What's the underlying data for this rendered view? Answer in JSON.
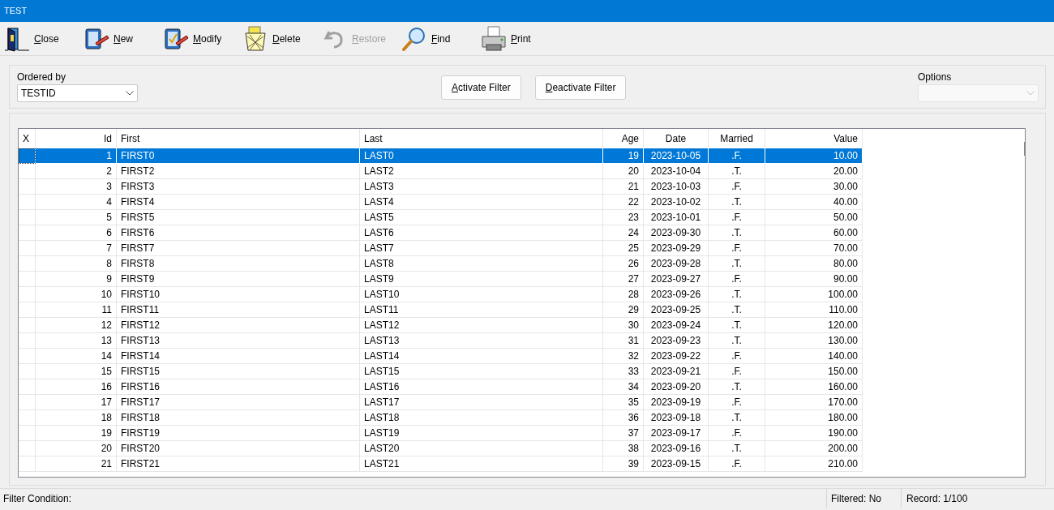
{
  "window": {
    "title": "TEST"
  },
  "toolbar": [
    {
      "label": "Close",
      "disabled": false
    },
    {
      "label": "New",
      "disabled": false
    },
    {
      "label": "Modify",
      "disabled": false
    },
    {
      "label": "Delete",
      "disabled": false
    },
    {
      "label": "Restore",
      "disabled": true
    },
    {
      "label": "Find",
      "disabled": false
    },
    {
      "label": "Print",
      "disabled": false
    }
  ],
  "filter_panel": {
    "ordered_by": {
      "label": "Ordered by",
      "value": "TESTID",
      "disabled": false
    },
    "buttons": [
      "Activate Filter",
      "Deactivate Filter"
    ],
    "options": {
      "label": "Options",
      "disabled": true
    }
  },
  "table": {
    "columns": [
      {
        "label": "X",
        "kind": "marker"
      },
      {
        "label": "Id",
        "kind": "number"
      },
      {
        "label": "First",
        "kind": "text"
      },
      {
        "label": "Last",
        "kind": "text"
      },
      {
        "label": "Age",
        "kind": "number"
      },
      {
        "label": "Date",
        "kind": "date"
      },
      {
        "label": "Married",
        "kind": "flag"
      },
      {
        "label": "Value",
        "kind": "number"
      }
    ],
    "rows": [
      {
        "selected": true,
        "cells": [
          "",
          "1",
          "FIRST0",
          "LAST0",
          "19",
          "2023-10-05",
          ".F.",
          "10.00"
        ]
      },
      {
        "selected": false,
        "cells": [
          "",
          "2",
          "FIRST2",
          "LAST2",
          "20",
          "2023-10-04",
          ".T.",
          "20.00"
        ]
      },
      {
        "selected": false,
        "cells": [
          "",
          "3",
          "FIRST3",
          "LAST3",
          "21",
          "2023-10-03",
          ".F.",
          "30.00"
        ]
      },
      {
        "selected": false,
        "cells": [
          "",
          "4",
          "FIRST4",
          "LAST4",
          "22",
          "2023-10-02",
          ".T.",
          "40.00"
        ]
      },
      {
        "selected": false,
        "cells": [
          "",
          "5",
          "FIRST5",
          "LAST5",
          "23",
          "2023-10-01",
          ".F.",
          "50.00"
        ]
      },
      {
        "selected": false,
        "cells": [
          "",
          "6",
          "FIRST6",
          "LAST6",
          "24",
          "2023-09-30",
          ".T.",
          "60.00"
        ]
      },
      {
        "selected": false,
        "cells": [
          "",
          "7",
          "FIRST7",
          "LAST7",
          "25",
          "2023-09-29",
          ".F.",
          "70.00"
        ]
      },
      {
        "selected": false,
        "cells": [
          "",
          "8",
          "FIRST8",
          "LAST8",
          "26",
          "2023-09-28",
          ".T.",
          "80.00"
        ]
      },
      {
        "selected": false,
        "cells": [
          "",
          "9",
          "FIRST9",
          "LAST9",
          "27",
          "2023-09-27",
          ".F.",
          "90.00"
        ]
      },
      {
        "selected": false,
        "cells": [
          "",
          "10",
          "FIRST10",
          "LAST10",
          "28",
          "2023-09-26",
          ".T.",
          "100.00"
        ]
      },
      {
        "selected": false,
        "cells": [
          "",
          "11",
          "FIRST11",
          "LAST11",
          "29",
          "2023-09-25",
          ".T.",
          "110.00"
        ]
      },
      {
        "selected": false,
        "cells": [
          "",
          "12",
          "FIRST12",
          "LAST12",
          "30",
          "2023-09-24",
          ".T.",
          "120.00"
        ]
      },
      {
        "selected": false,
        "cells": [
          "",
          "13",
          "FIRST13",
          "LAST13",
          "31",
          "2023-09-23",
          ".T.",
          "130.00"
        ]
      },
      {
        "selected": false,
        "cells": [
          "",
          "14",
          "FIRST14",
          "LAST14",
          "32",
          "2023-09-22",
          ".F.",
          "140.00"
        ]
      },
      {
        "selected": false,
        "cells": [
          "",
          "15",
          "FIRST15",
          "LAST15",
          "33",
          "2023-09-21",
          ".F.",
          "150.00"
        ]
      },
      {
        "selected": false,
        "cells": [
          "",
          "16",
          "FIRST16",
          "LAST16",
          "34",
          "2023-09-20",
          ".T.",
          "160.00"
        ]
      },
      {
        "selected": false,
        "cells": [
          "",
          "17",
          "FIRST17",
          "LAST17",
          "35",
          "2023-09-19",
          ".F.",
          "170.00"
        ]
      },
      {
        "selected": false,
        "cells": [
          "",
          "18",
          "FIRST18",
          "LAST18",
          "36",
          "2023-09-18",
          ".T.",
          "180.00"
        ]
      },
      {
        "selected": false,
        "cells": [
          "",
          "19",
          "FIRST19",
          "LAST19",
          "37",
          "2023-09-17",
          ".F.",
          "190.00"
        ]
      },
      {
        "selected": false,
        "cells": [
          "",
          "20",
          "FIRST20",
          "LAST20",
          "38",
          "2023-09-16",
          ".T.",
          "200.00"
        ]
      },
      {
        "selected": false,
        "cells": [
          "",
          "21",
          "FIRST21",
          "LAST21",
          "39",
          "2023-09-15",
          ".F.",
          "210.00"
        ]
      }
    ]
  },
  "status_bar": {
    "filter_condition": "Filter Condition:",
    "filtered": "Filtered: No",
    "record": "Record: 1/100"
  }
}
